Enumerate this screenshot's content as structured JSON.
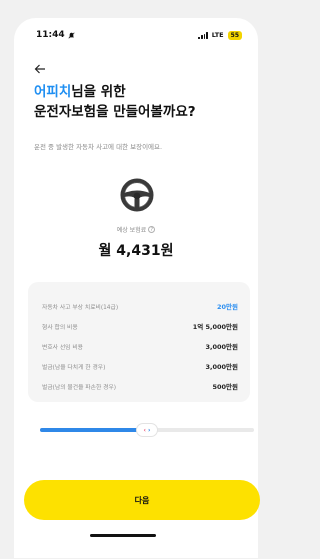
{
  "status_bar": {
    "time": "11:44",
    "network": "LTE",
    "battery": "55"
  },
  "header": {
    "title_highlight": "어피치",
    "title_line1_rest": "님을 위한",
    "title_line2": "운전자보험을 만들어볼까요?",
    "subtitle": "운전 중 발생한 자동차 사고에 대한 보장이에요."
  },
  "premium": {
    "label": "예상 보험료",
    "value": "월 4,431원"
  },
  "coverage": [
    {
      "label": "자동차 사고 부상 치료비(14급)",
      "value": "20만원",
      "accent": "#2b8ef0"
    },
    {
      "label": "형사 합의 비용",
      "value": "1억 5,000만원"
    },
    {
      "label": "변호사 선임 비용",
      "value": "3,000만원"
    },
    {
      "label": "벌금(남을 다치게 한 경우)",
      "value": "3,000만원"
    },
    {
      "label": "벌금(남의 물건을 파손한 경우)",
      "value": "500만원"
    }
  ],
  "slider": {
    "level": 0.5,
    "thumb_left": "‹",
    "thumb_right": "›"
  },
  "next_button": {
    "label": "다음"
  },
  "colors": {
    "accent": "#1f8ff2",
    "cta": "#fde100"
  },
  "icons": {
    "back": "arrow-left-icon",
    "wheel": "steering-wheel-icon",
    "info": "info-icon"
  }
}
